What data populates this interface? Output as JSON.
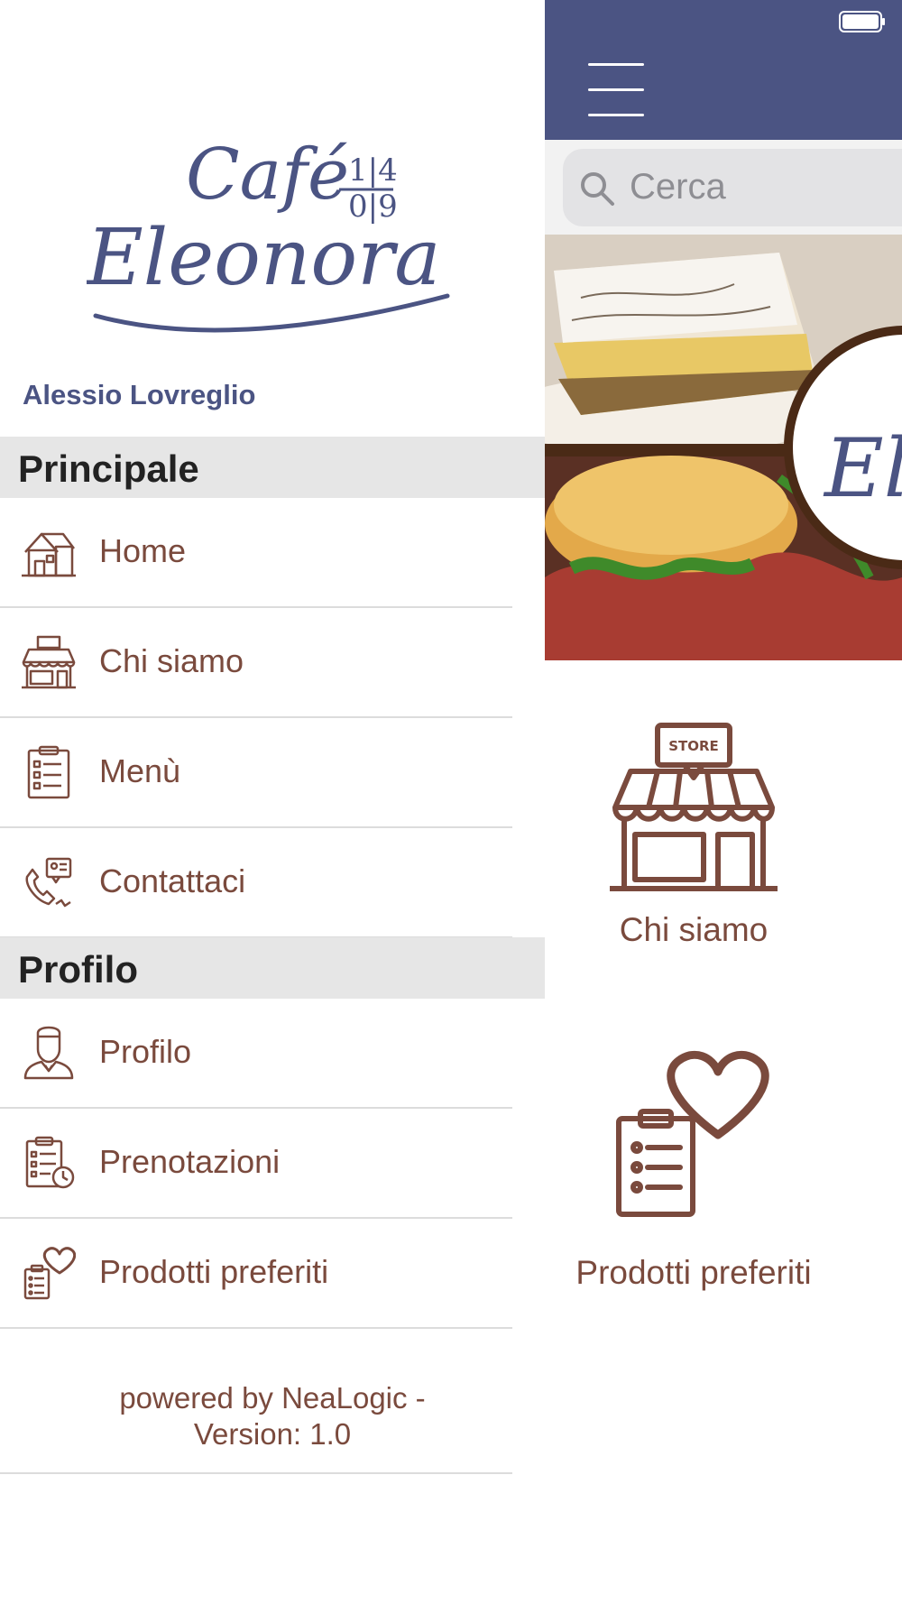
{
  "colors": {
    "header": "#4b5483",
    "accent_brown": "#7a4a3d",
    "section_bg": "#e6e6e6"
  },
  "drawer": {
    "logo": {
      "line1": "Café",
      "line2": "Eleonora",
      "mark_top": "1|4",
      "mark_bottom": "0|9"
    },
    "user_name": "Alessio Lovreglio",
    "sections": [
      {
        "title": "Principale",
        "items": [
          {
            "label": "Home",
            "icon": "house-icon"
          },
          {
            "label": "Chi siamo",
            "icon": "store-icon"
          },
          {
            "label": "Menù",
            "icon": "clipboard-list-icon"
          },
          {
            "label": "Contattaci",
            "icon": "phone-contact-icon"
          }
        ]
      },
      {
        "title": "Profilo",
        "items": [
          {
            "label": "Profilo",
            "icon": "user-profile-icon"
          },
          {
            "label": "Prenotazioni",
            "icon": "clipboard-clock-icon"
          },
          {
            "label": "Prodotti preferiti",
            "icon": "clipboard-heart-icon"
          }
        ]
      }
    ],
    "footer_line1": "powered by NeaLogic -",
    "footer_line2": "Version: 1.0"
  },
  "main": {
    "search": {
      "placeholder": "Cerca"
    },
    "tiles": [
      {
        "label": "Chi siamo",
        "icon": "store-icon",
        "badge": "STORE"
      },
      {
        "label": "Prodotti preferiti",
        "icon": "clipboard-heart-icon"
      }
    ]
  }
}
